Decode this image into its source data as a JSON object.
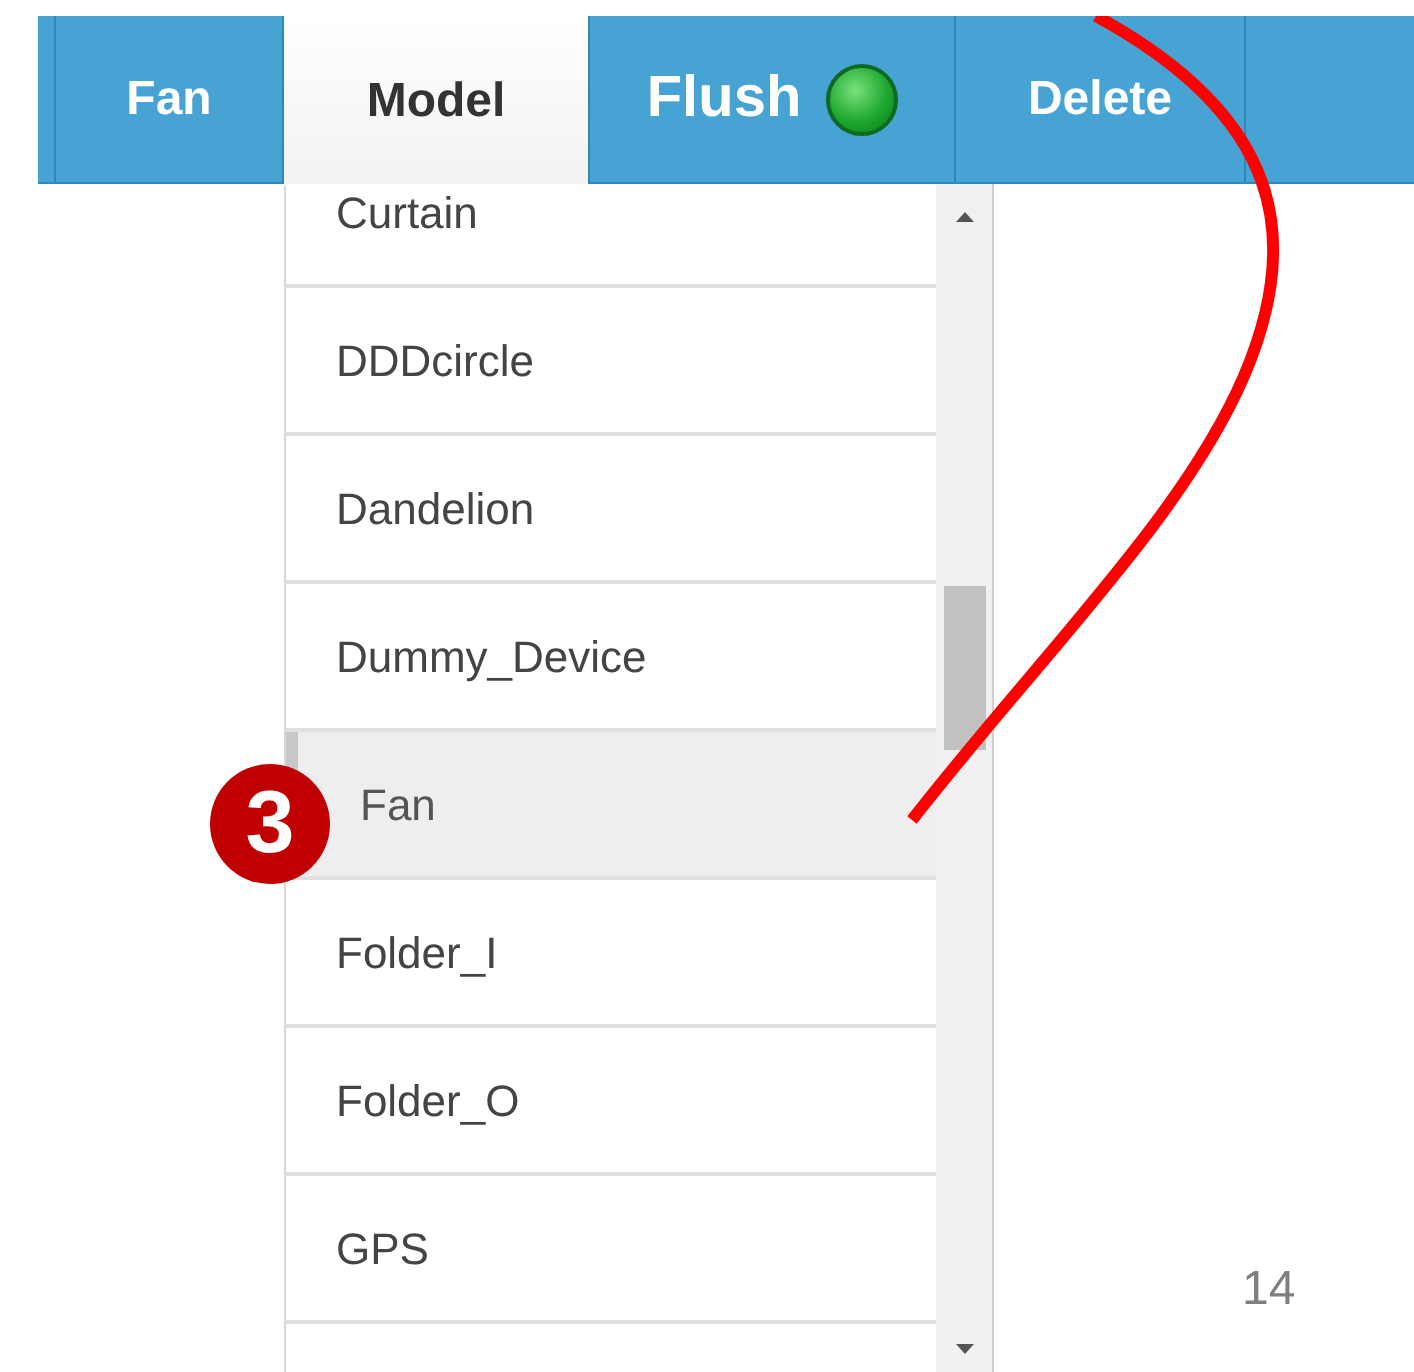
{
  "tabs": [
    {
      "label": "Fan",
      "selected": false,
      "status_light": false
    },
    {
      "label": "Model",
      "selected": true,
      "status_light": false
    },
    {
      "label": "Flush",
      "selected": false,
      "status_light": true
    },
    {
      "label": "Delete",
      "selected": false,
      "status_light": false
    }
  ],
  "model_list": [
    {
      "label": "Curtain",
      "selected": false
    },
    {
      "label": "DDDcircle",
      "selected": false
    },
    {
      "label": "Dandelion",
      "selected": false
    },
    {
      "label": "Dummy_Device",
      "selected": false
    },
    {
      "label": "Fan",
      "selected": true
    },
    {
      "label": "Folder_I",
      "selected": false
    },
    {
      "label": "Folder_O",
      "selected": false
    },
    {
      "label": "GPS",
      "selected": false
    }
  ],
  "step_badge": "3",
  "page_number": "14"
}
